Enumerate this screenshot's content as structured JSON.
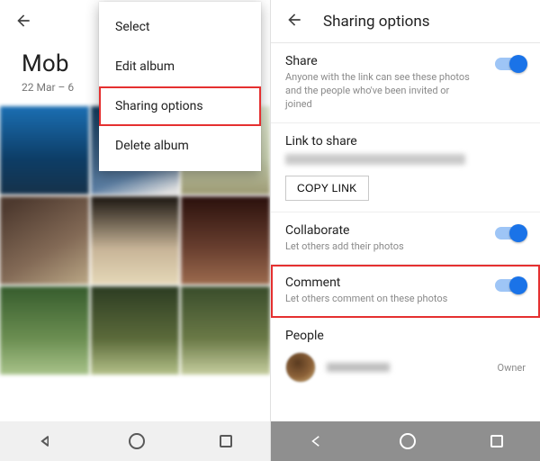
{
  "left": {
    "album": {
      "title": "Mob",
      "subtitle": "22 Mar – 6"
    },
    "menu": {
      "select": "Select",
      "edit": "Edit album",
      "sharing": "Sharing options",
      "delete": "Delete album"
    }
  },
  "right": {
    "title": "Sharing options",
    "share": {
      "label": "Share",
      "desc": "Anyone with the link can see these photos and the people who've been invited or joined"
    },
    "link": {
      "label": "Link to share",
      "copy_btn": "COPY LINK"
    },
    "collaborate": {
      "label": "Collaborate",
      "desc": "Let others add their photos"
    },
    "comment": {
      "label": "Comment",
      "desc": "Let others comment on these photos"
    },
    "people": {
      "label": "People",
      "role": "Owner"
    }
  }
}
